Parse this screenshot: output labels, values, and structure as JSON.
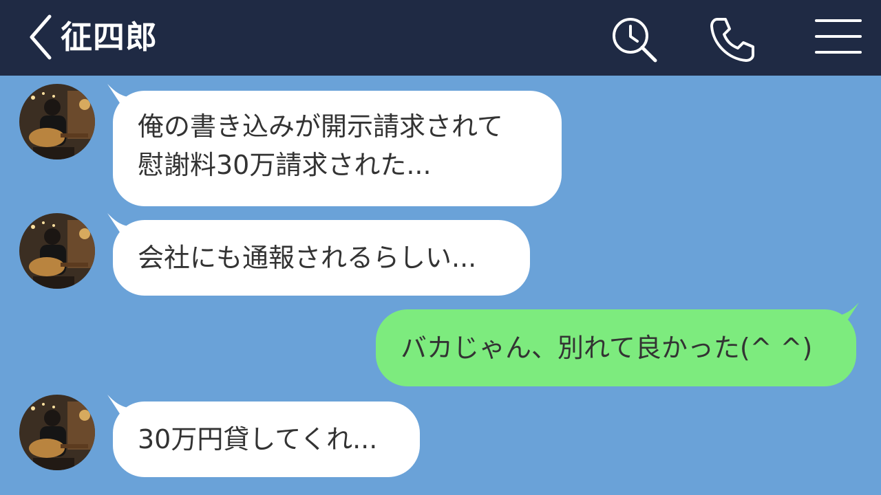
{
  "header": {
    "title": "征四郎",
    "back_icon": "chevron-left-icon",
    "search_icon": "search-history-icon",
    "call_icon": "phone-icon",
    "menu_icon": "hamburger-menu-icon",
    "background": "#1f2a44"
  },
  "chat": {
    "background": "#6aa2d8",
    "incoming_bubble_color": "#ffffff",
    "outgoing_bubble_color": "#7deb7e",
    "messages": [
      {
        "sender": "other",
        "lines": [
          "俺の書き込みが開示請求されて",
          "慰謝料30万請求された..."
        ]
      },
      {
        "sender": "other",
        "lines": [
          "会社にも通報されるらしい..."
        ]
      },
      {
        "sender": "me",
        "lines": [
          "バカじゃん、別れて良かった(^ ^)"
        ]
      },
      {
        "sender": "other",
        "lines": [
          "30万円貸してくれ..."
        ]
      }
    ]
  }
}
